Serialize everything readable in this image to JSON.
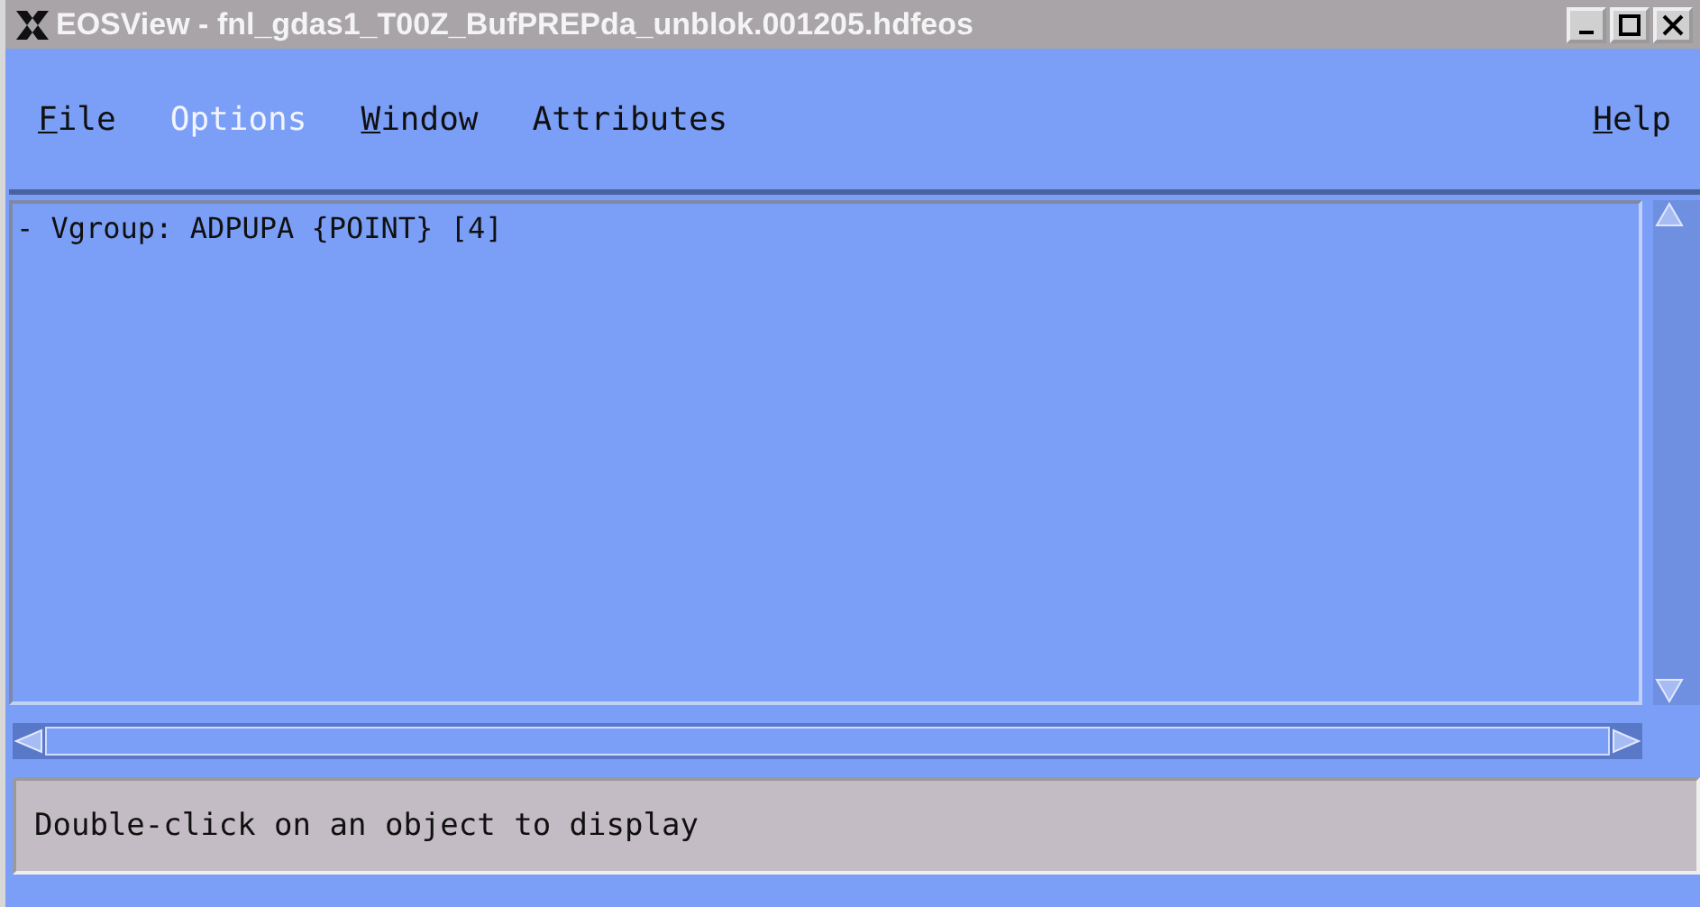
{
  "window": {
    "title": "EOSView - fnl_gdas1_T00Z_BufPREPda_unblok.001205.hdfeos"
  },
  "menu": [
    {
      "label": "File",
      "disabled": false,
      "mnemonic": true
    },
    {
      "label": "Options",
      "disabled": true,
      "mnemonic": false
    },
    {
      "label": "Window",
      "disabled": false,
      "mnemonic": true
    },
    {
      "label": "Attributes",
      "disabled": false,
      "mnemonic": false
    }
  ],
  "help_menu": {
    "label": "Help",
    "disabled": false,
    "mnemonic": true
  },
  "tree": [
    {
      "label": "- Vgroup: ADPUPA {POINT} [4]",
      "selected": false
    }
  ],
  "status_bar": "Double-click on an object to display"
}
